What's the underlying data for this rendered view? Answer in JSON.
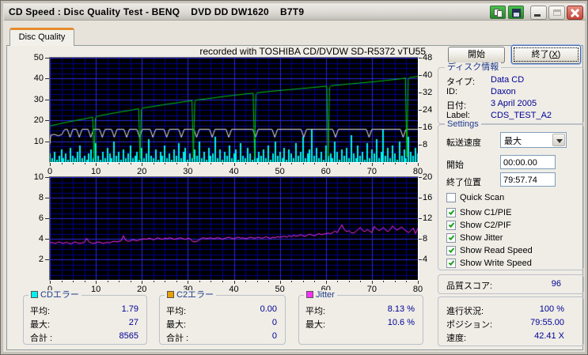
{
  "window": {
    "title": "CD Speed : Disc Quality Test - BENQ    DVD DD DW1620    B7T9"
  },
  "icons": {
    "titlebar": [
      "copy-icon",
      "save-icon",
      "minimize-icon",
      "maximize-icon",
      "close-icon"
    ],
    "combo": "chevron-down-icon",
    "checkbox": "green-checkmark-icon",
    "legend": [
      "cyan-square",
      "orange-square",
      "magenta-square"
    ]
  },
  "colors": {
    "value_text": "#000096",
    "read_speed_green": "#00C814",
    "write_speed_white": "#E6E6E6",
    "c1_cyan": "#00F0F0",
    "c2_orange": "#E8A000",
    "jitter_magenta": "#FF30FF",
    "grid_major": "#2A2AE0",
    "grid_minor": "#00008C",
    "plot_bg": "#000000",
    "tab_accent": "#E68B2C"
  },
  "tab": {
    "label": "Disc Quality"
  },
  "chart_header": "recorded with TOSHIBA CD/DVDW SD-R5372 vTU55",
  "buttons": {
    "start": "開始",
    "exit_pre": "終了(",
    "exit_key": "X",
    "exit_post": ")"
  },
  "disc_info": {
    "title": "ディスク情報",
    "rows": [
      {
        "label": "タイプ:",
        "value": "Data CD"
      },
      {
        "label": "ID:",
        "value": "Daxon"
      },
      {
        "label": "日付:",
        "value": "3 April 2005"
      },
      {
        "label": "Label:",
        "value": "CDS_TEST_A2"
      }
    ]
  },
  "settings": {
    "title": "Settings",
    "speed_label": "転送速度",
    "speed_value": "最大",
    "start_label": "開始",
    "start_value": "00:00.00",
    "end_label": "終了位置",
    "end_value": "79:57.74",
    "checkboxes": [
      {
        "label": "Quick Scan",
        "checked": false
      },
      {
        "label": "Show C1/PIE",
        "checked": true
      },
      {
        "label": "Show C2/PIF",
        "checked": true
      },
      {
        "label": "Show Jitter",
        "checked": true
      },
      {
        "label": "Show Read Speed",
        "checked": true
      },
      {
        "label": "Show Write Speed",
        "checked": true
      }
    ]
  },
  "quality": {
    "label": "品質スコア:",
    "value": "96"
  },
  "progress": {
    "rows": [
      {
        "label": "進行状況:",
        "value": "100 %"
      },
      {
        "label": "ポジション:",
        "value": "79:55.00"
      },
      {
        "label": "速度:",
        "value": "42.41 X"
      }
    ]
  },
  "stats": {
    "groups": [
      {
        "title": "CDエラー",
        "color": "#00F0F0",
        "rows": [
          {
            "label": "平均:",
            "value": "1.79"
          },
          {
            "label": "最大:",
            "value": "27"
          },
          {
            "label": "合計 :",
            "value": "8565"
          }
        ]
      },
      {
        "title": "C2エラー",
        "color": "#E8A000",
        "rows": [
          {
            "label": "平均:",
            "value": "0.00"
          },
          {
            "label": "最大:",
            "value": "0"
          },
          {
            "label": "合計 :",
            "value": "0"
          }
        ]
      },
      {
        "title": "Jitter",
        "color": "#FF30FF",
        "rows": [
          {
            "label": "平均:",
            "value": "8.13 %"
          },
          {
            "label": "最大:",
            "value": "10.6 %"
          }
        ]
      }
    ]
  },
  "chart_data": [
    {
      "type": "line",
      "title": "recorded with TOSHIBA CD/DVDW SD-R5372 vTU55",
      "x": {
        "range": [
          0,
          80
        ],
        "major": 10,
        "minor": 2.5,
        "labels": [
          0,
          10,
          20,
          30,
          40,
          50,
          60,
          70,
          80
        ]
      },
      "y_left": {
        "range": [
          0,
          50
        ],
        "major": 10,
        "minor": 2.5,
        "labels": [
          10,
          20,
          30,
          40,
          50
        ]
      },
      "y_right": {
        "range": [
          0,
          48
        ],
        "labels": [
          8,
          16,
          24,
          32,
          40,
          48
        ]
      },
      "series": [
        {
          "name": "c1-errors",
          "label": "CDエラー",
          "color": "#00F0F0",
          "draw": "bars",
          "x_step": 0.5,
          "values": [
            4,
            2,
            5,
            1,
            3,
            6,
            2,
            4,
            1,
            7,
            3,
            2,
            5,
            8,
            2,
            3,
            1,
            4,
            6,
            2,
            9,
            3,
            1,
            5,
            2,
            7,
            4,
            2,
            10,
            3,
            5,
            1,
            6,
            2,
            4,
            8,
            2,
            3,
            5,
            1,
            7,
            2,
            4,
            11,
            3,
            2,
            6,
            1,
            5,
            3,
            8,
            2,
            4,
            1,
            6,
            3,
            9,
            2,
            5,
            7,
            1,
            4,
            2,
            6,
            3,
            10,
            2,
            5,
            1,
            7,
            3,
            4,
            12,
            2,
            6,
            1,
            5,
            3,
            8,
            2,
            4,
            6,
            1,
            9,
            3,
            2,
            7,
            4,
            1,
            11,
            2,
            5,
            3,
            6,
            2,
            8,
            1,
            4,
            10,
            3,
            5,
            2,
            7,
            1,
            6,
            4,
            2,
            9,
            3,
            5,
            12,
            2,
            4,
            6,
            16,
            3,
            7,
            2,
            5,
            1,
            8,
            3,
            4,
            2,
            10,
            5,
            1,
            6,
            3,
            7,
            2,
            13,
            4,
            2,
            8,
            3,
            5,
            1,
            9,
            2,
            6,
            4,
            11,
            2,
            5,
            16,
            3,
            7,
            2,
            8,
            4,
            1,
            10,
            3,
            6,
            2,
            12,
            5,
            3,
            7,
            4
          ]
        },
        {
          "name": "write-speed",
          "label": "Show Write Speed",
          "color": "#E6E6E6",
          "draw": "line",
          "points": [
            [
              0,
              8.5
            ],
            [
              0.2,
              12.9
            ],
            [
              1.0,
              13.3
            ],
            [
              1.8,
              12.6
            ],
            [
              2.6,
              13.2
            ],
            [
              3.2,
              15.6
            ],
            [
              3.8,
              15.7
            ],
            [
              4.4,
              11.9
            ],
            [
              5.0,
              15.7
            ],
            [
              5.8,
              15.7
            ],
            [
              6.4,
              11.9
            ],
            [
              7.0,
              15.7
            ],
            [
              8.3,
              15.7
            ],
            [
              8.9,
              11.9
            ],
            [
              9.5,
              15.7
            ],
            [
              10.8,
              15.7
            ],
            [
              11.4,
              11.9
            ],
            [
              12.0,
              15.7
            ],
            [
              13.4,
              15.7
            ],
            [
              14.0,
              11.9
            ],
            [
              14.6,
              15.7
            ],
            [
              16.1,
              15.7
            ],
            [
              16.7,
              11.9
            ],
            [
              17.3,
              15.7
            ],
            [
              18.9,
              15.7
            ],
            [
              19.5,
              11.9
            ],
            [
              20.1,
              15.7
            ],
            [
              21.8,
              15.7
            ],
            [
              22.4,
              11.9
            ],
            [
              23.0,
              15.7
            ],
            [
              24.8,
              15.7
            ],
            [
              25.4,
              11.9
            ],
            [
              26.0,
              15.7
            ],
            [
              28.0,
              15.7
            ],
            [
              28.6,
              11.9
            ],
            [
              29.2,
              15.7
            ],
            [
              31.3,
              15.7
            ],
            [
              31.9,
              11.9
            ],
            [
              32.5,
              15.7
            ],
            [
              34.7,
              15.7
            ],
            [
              35.3,
              11.9
            ],
            [
              35.9,
              15.7
            ],
            [
              38.3,
              15.7
            ],
            [
              38.9,
              11.9
            ],
            [
              39.5,
              15.7
            ],
            [
              44.1,
              15.7
            ],
            [
              44.7,
              11.9
            ],
            [
              45.3,
              15.7
            ],
            [
              48.3,
              15.7
            ],
            [
              48.9,
              11.9
            ],
            [
              49.5,
              15.7
            ],
            [
              54.6,
              15.7
            ],
            [
              55.2,
              11.9
            ],
            [
              55.8,
              15.7
            ],
            [
              61.5,
              15.7
            ],
            [
              62.1,
              11.9
            ],
            [
              62.7,
              15.7
            ],
            [
              68.8,
              15.7
            ],
            [
              69.4,
              11.9
            ],
            [
              70.0,
              15.7
            ],
            [
              76.2,
              15.7
            ],
            [
              76.8,
              11.9
            ],
            [
              77.4,
              15.7
            ],
            [
              80,
              15.7
            ]
          ]
        },
        {
          "name": "read-speed",
          "label": "Show Read Speed",
          "color": "#00C814",
          "draw": "line",
          "points": [
            [
              0,
              17.3
            ],
            [
              2,
              18.3
            ],
            [
              4,
              19.2
            ],
            [
              6,
              20.1
            ],
            [
              8,
              20.9
            ],
            [
              9.3,
              21.6
            ],
            [
              9.6,
              1.2
            ],
            [
              9.9,
              21.0
            ],
            [
              10.2,
              21.9
            ],
            [
              12,
              22.7
            ],
            [
              14,
              23.5
            ],
            [
              16,
              24.3
            ],
            [
              18,
              25.0
            ],
            [
              19.3,
              25.6
            ],
            [
              19.6,
              1.4
            ],
            [
              19.9,
              25.1
            ],
            [
              20.2,
              25.9
            ],
            [
              22,
              26.5
            ],
            [
              24,
              27.2
            ],
            [
              26,
              27.9
            ],
            [
              28,
              28.5
            ],
            [
              30,
              29.2
            ],
            [
              30.9,
              29.5
            ],
            [
              31.2,
              1.7
            ],
            [
              31.5,
              28.9
            ],
            [
              31.8,
              29.7
            ],
            [
              34,
              30.3
            ],
            [
              36,
              30.9
            ],
            [
              38,
              31.5
            ],
            [
              40,
              32.0
            ],
            [
              42,
              32.5
            ],
            [
              44.2,
              33.0
            ],
            [
              44.5,
              1.9
            ],
            [
              44.8,
              32.4
            ],
            [
              45.1,
              33.2
            ],
            [
              48,
              33.9
            ],
            [
              51,
              34.5
            ],
            [
              54,
              35.1
            ],
            [
              57,
              35.7
            ],
            [
              60.2,
              36.4
            ],
            [
              60.5,
              2.1
            ],
            [
              60.8,
              35.8
            ],
            [
              61.1,
              36.6
            ],
            [
              64,
              37.2
            ],
            [
              67,
              37.8
            ],
            [
              70,
              38.4
            ],
            [
              73,
              39.1
            ],
            [
              76,
              39.8
            ],
            [
              77.3,
              40.3
            ],
            [
              77.6,
              2.3
            ],
            [
              77.9,
              39.7
            ],
            [
              78.2,
              40.5
            ],
            [
              80,
              41.0
            ]
          ]
        }
      ]
    },
    {
      "type": "line",
      "x": {
        "range": [
          0,
          80
        ],
        "major": 10,
        "minor": 2.5,
        "labels": [
          0,
          10,
          20,
          30,
          40,
          50,
          60,
          70,
          80
        ]
      },
      "y_left": {
        "range": [
          0,
          10
        ],
        "major": 2,
        "minor": 0.5,
        "labels": [
          2,
          4,
          6,
          8,
          10
        ]
      },
      "y_right": {
        "range": [
          0,
          20
        ],
        "labels": [
          4,
          8,
          12,
          16,
          20
        ]
      },
      "series": [
        {
          "name": "jitter",
          "label": "Jitter",
          "color": "#FF30FF",
          "draw": "line",
          "x_step": 0.5,
          "values": [
            3.6,
            3.65,
            3.55,
            3.6,
            3.7,
            3.6,
            3.55,
            3.65,
            3.6,
            3.5,
            3.6,
            3.7,
            3.6,
            3.55,
            3.6,
            3.65,
            4.05,
            3.7,
            3.6,
            3.55,
            3.6,
            3.7,
            3.65,
            3.55,
            3.6,
            3.65,
            3.6,
            3.7,
            3.75,
            3.7,
            3.75,
            3.8,
            4.3,
            3.85,
            3.75,
            3.8,
            3.9,
            3.85,
            3.8,
            3.9,
            3.95,
            4.0,
            3.95,
            4.05,
            4.0,
            3.9,
            4.0,
            4.1,
            4.0,
            3.95,
            4.05,
            4.0,
            4.1,
            4.05,
            3.95,
            4.0,
            4.05,
            4.1,
            4.0,
            3.95,
            4.05,
            4.0,
            3.75,
            3.7,
            3.75,
            3.9,
            4.05,
            4.1,
            4.0,
            4.05,
            4.1,
            4.0,
            4.05,
            4.1,
            4.05,
            3.95,
            4.05,
            4.1,
            4.15,
            4.05,
            4.0,
            4.1,
            4.15,
            4.05,
            4.1,
            4.0,
            4.05,
            4.15,
            4.1,
            4.05,
            4.1,
            4.15,
            4.05,
            4.1,
            4.2,
            4.1,
            4.05,
            4.15,
            4.1,
            4.2,
            4.15,
            4.2,
            4.25,
            4.15,
            4.3,
            4.2,
            4.35,
            4.25,
            4.3,
            4.4,
            4.3,
            4.25,
            4.35,
            4.45,
            4.35,
            4.3,
            4.4,
            4.5,
            4.4,
            4.45,
            4.5,
            4.55,
            4.5,
            4.6,
            4.75,
            4.6,
            5.0,
            5.35,
            4.9,
            4.7,
            4.8,
            4.6,
            4.55,
            4.7,
            4.9,
            5.1,
            4.8,
            4.7,
            4.9,
            4.75,
            4.6,
            5.2,
            5.0,
            4.8,
            4.9,
            5.1,
            4.85,
            4.7,
            4.9,
            5.25,
            5.0,
            4.85,
            5.0,
            5.15,
            4.9,
            4.75,
            4.6,
            4.8,
            5.05,
            4.5,
            5.0
          ]
        }
      ]
    }
  ]
}
